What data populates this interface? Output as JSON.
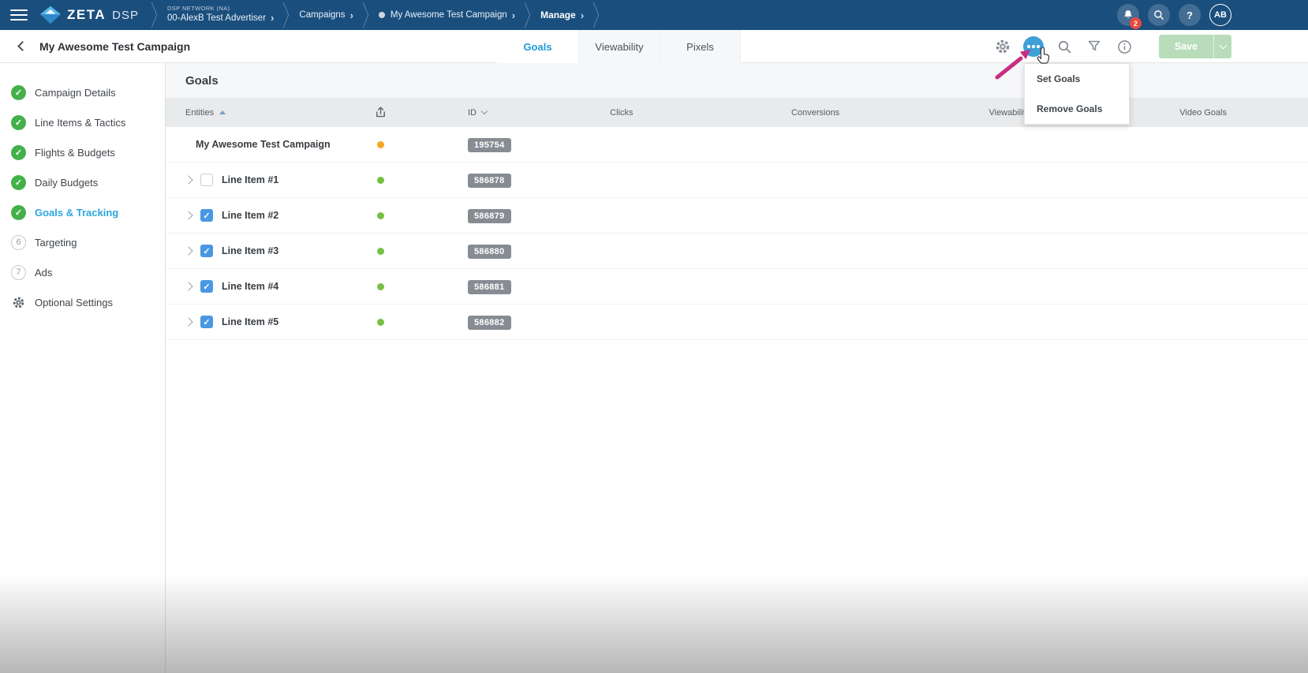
{
  "colors": {
    "topnav_bg": "#1a4e7d",
    "accent_blue": "#209bd8",
    "dots_button_active": "#3d9fd6",
    "green_check": "#43b049",
    "orange_status_dot": "#f5a623",
    "green_status_dot": "#76c043",
    "id_badge_bg": "#868c92",
    "save_disabled_bg": "#b9ddbb",
    "notification_badge": "#e8493d",
    "annotation_arrow": "#c92c83"
  },
  "topnav": {
    "brand": "ZETA",
    "brand_product": "DSP",
    "network_label": "DSP NETWORK (NA)",
    "breadcrumbs": [
      {
        "label": "00-AlexB Test Advertiser"
      },
      {
        "label": "Campaigns"
      },
      {
        "label": "My Awesome Test Campaign"
      },
      {
        "label": "Manage"
      }
    ],
    "notification_count": "2",
    "help_label": "?",
    "avatar_initials": "AB"
  },
  "header": {
    "title": "My Awesome Test Campaign",
    "tabs": [
      {
        "label": "Goals",
        "active": true
      },
      {
        "label": "Viewability",
        "active": false
      },
      {
        "label": "Pixels",
        "active": false
      }
    ],
    "save_label": "Save"
  },
  "actions_menu": {
    "items": [
      {
        "label": "Set Goals"
      },
      {
        "label": "Remove Goals"
      }
    ]
  },
  "sidebar": {
    "items": [
      {
        "label": "Campaign Details",
        "status": "complete",
        "active": false
      },
      {
        "label": "Line Items & Tactics",
        "status": "complete",
        "active": false
      },
      {
        "label": "Flights & Budgets",
        "status": "complete",
        "active": false
      },
      {
        "label": "Daily Budgets",
        "status": "complete",
        "active": false
      },
      {
        "label": "Goals & Tracking",
        "status": "complete",
        "active": true
      },
      {
        "label": "Targeting",
        "status": "step",
        "step": "6",
        "active": false
      },
      {
        "label": "Ads",
        "status": "step",
        "step": "7",
        "active": false
      },
      {
        "label": "Optional Settings",
        "status": "settings",
        "active": false
      }
    ]
  },
  "main": {
    "section_title": "Goals",
    "table": {
      "columns": {
        "entities": "Entities",
        "id": "ID",
        "clicks": "Clicks",
        "conversions": "Conversions",
        "viewability": "Viewability",
        "video_goals": "Video Goals"
      },
      "rows": [
        {
          "name": "My Awesome Test Campaign",
          "id": "195754",
          "level": "campaign",
          "status_dot": "orange"
        },
        {
          "name": "Line Item #1",
          "id": "586878",
          "level": "line-item",
          "status_dot": "green",
          "checked": false
        },
        {
          "name": "Line Item #2",
          "id": "586879",
          "level": "line-item",
          "status_dot": "green",
          "checked": true
        },
        {
          "name": "Line Item #3",
          "id": "586880",
          "level": "line-item",
          "status_dot": "green",
          "checked": true
        },
        {
          "name": "Line Item #4",
          "id": "586881",
          "level": "line-item",
          "status_dot": "green",
          "checked": true
        },
        {
          "name": "Line Item #5",
          "id": "586882",
          "level": "line-item",
          "status_dot": "green",
          "checked": true
        }
      ]
    }
  }
}
